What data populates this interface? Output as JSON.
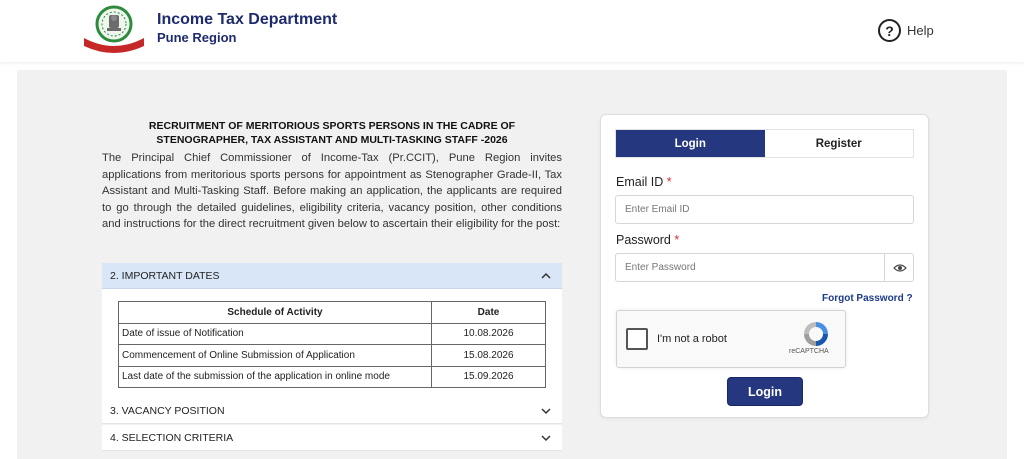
{
  "header": {
    "title": "Income Tax Department",
    "subtitle": "Pune Region",
    "help_label": "Help",
    "help_symbol": "?"
  },
  "recruitment": {
    "title_line1": "RECRUITMENT OF MERITORIOUS SPORTS PERSONS IN THE CADRE OF",
    "title_line2": "STENOGRAPHER, TAX ASSISTANT AND MULTI-TASKING STAFF -2026",
    "body": "The Principal Chief Commissioner of Income-Tax (Pr.CCIT), Pune Region invites applications from meritorious sports persons for appointment as Stenographer Grade-II, Tax Assistant and Multi-Tasking Staff. Before making an application, the applicants are required to go through the detailed guidelines, eligibility criteria, vacancy position, other conditions and instructions for the direct recruitment given below to ascertain their eligibility for the post:"
  },
  "accordion": {
    "sections": [
      {
        "label": "2. IMPORTANT DATES",
        "expanded": true
      },
      {
        "label": "3. VACANCY POSITION",
        "expanded": false
      },
      {
        "label": "4. SELECTION CRITERIA",
        "expanded": false
      }
    ],
    "schedule": {
      "headers": [
        "Schedule of Activity",
        "Date"
      ],
      "rows": [
        [
          "Date of issue of Notification",
          "10.08.2026"
        ],
        [
          "Commencement of Online Submission of Application",
          "15.08.2026"
        ],
        [
          "Last date of the submission of the application in online mode",
          "15.09.2026"
        ]
      ]
    }
  },
  "auth": {
    "tabs": [
      "Login",
      "Register"
    ],
    "active_tab": "Login",
    "email_label": "Email ID",
    "email_placeholder": "Enter Email ID",
    "password_label": "Password",
    "password_placeholder": "Enter Password",
    "required_mark": "*",
    "forgot_label": "Forgot Password ?",
    "captcha_text": "I'm not a robot",
    "captcha_brand": "reCAPTCHA",
    "login_button": "Login"
  },
  "colors": {
    "brand_navy": "#25377f",
    "title_navy": "#1e2c6e",
    "accordion_active_bg": "#d9e6f7",
    "required_red": "#d32f2f",
    "page_bg": "#f1f1f1"
  }
}
